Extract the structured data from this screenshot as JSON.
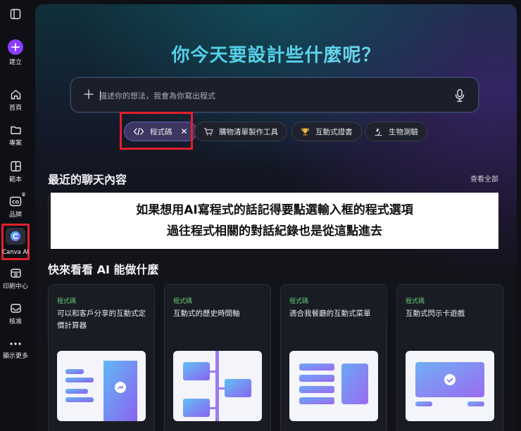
{
  "sidebar": {
    "create_label": "建立",
    "items": [
      {
        "label": "首頁",
        "icon": "home-icon"
      },
      {
        "label": "專案",
        "icon": "folder-icon"
      },
      {
        "label": "範本",
        "icon": "template-icon"
      },
      {
        "label": "品牌",
        "icon": "brand-icon"
      },
      {
        "label": "Canva AI",
        "icon": "canva-ai-icon"
      },
      {
        "label": "印刷中心",
        "icon": "print-icon"
      },
      {
        "label": "核准",
        "icon": "inbox-icon"
      },
      {
        "label": "顯示更多",
        "icon": "more-icon"
      }
    ],
    "brand_badge": "♛"
  },
  "hero": {
    "title": "你今天要設計些什麼呢？"
  },
  "prompt": {
    "placeholder": "描述你的想法，我會為你寫出程式"
  },
  "chips": [
    {
      "label": "程式碼",
      "icon": "code-icon",
      "active": true
    },
    {
      "label": "購物清單製作工具",
      "icon": "cart-icon"
    },
    {
      "label": "互動式證書",
      "icon": "trophy-icon"
    },
    {
      "label": "生物測驗",
      "icon": "microscope-icon"
    }
  ],
  "recent": {
    "title": "最近的聊天內容",
    "view_all": "查看全部"
  },
  "annotation": {
    "line1": "如果想用AI寫程式的話記得要點選輸入框的程式選項",
    "line2": "過往程式相關的對話紀錄也是從這點進去"
  },
  "explore": {
    "title": "快來看看 AI 能做什麼",
    "cards": [
      {
        "tag": "程式碼",
        "title": "可以和客戶分享的互動式定價計算器"
      },
      {
        "tag": "程式碼",
        "title": "互動式的歷史時間軸"
      },
      {
        "tag": "程式碼",
        "title": "適合我餐廳的互動式菜單"
      },
      {
        "tag": "程式碼",
        "title": "互動式閃示卡遊戲"
      }
    ]
  },
  "colors": {
    "accent": "#8b3dff",
    "highlight_red": "#e3202a",
    "tag_green": "#62c877",
    "title_cyan": "#4fc9ee"
  }
}
